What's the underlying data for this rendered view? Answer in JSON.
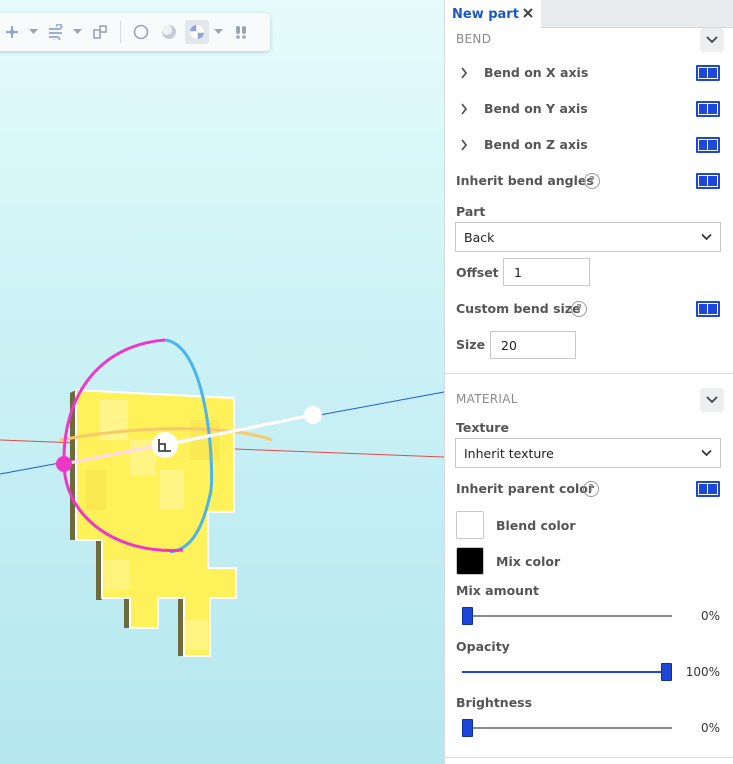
{
  "tab": {
    "title": "New part"
  },
  "toolbar": {
    "icons": [
      "move-icon",
      "wind-icon",
      "pivot-icon",
      "circle-icon",
      "half-shade-icon",
      "globe-icon",
      "footprint-icon"
    ]
  },
  "bend": {
    "section_title": "BEND",
    "axes": [
      {
        "label": "Bend on X axis",
        "enabled": true
      },
      {
        "label": "Bend on Y axis",
        "enabled": true
      },
      {
        "label": "Bend on Z axis",
        "enabled": true
      }
    ],
    "inherit_angles": {
      "label": "Inherit bend angles",
      "help": "?",
      "enabled": true
    },
    "part": {
      "label": "Part",
      "value": "Back"
    },
    "offset": {
      "label": "Offset",
      "value": "1"
    },
    "custom_size": {
      "label": "Custom bend size",
      "help": "?",
      "enabled": true
    },
    "size": {
      "label": "Size",
      "value": "20"
    }
  },
  "material": {
    "section_title": "MATERIAL",
    "texture": {
      "label": "Texture",
      "value": "Inherit texture"
    },
    "inherit_color": {
      "label": "Inherit parent color",
      "help": "?",
      "enabled": true
    },
    "blend_color": {
      "label": "Blend color",
      "color": "#ffffff"
    },
    "mix_color": {
      "label": "Mix color",
      "color": "#000000"
    },
    "mix_amount": {
      "label": "Mix amount",
      "value_text": "0%",
      "value": 0
    },
    "opacity": {
      "label": "Opacity",
      "value_text": "100%",
      "value": 100
    },
    "brightness": {
      "label": "Brightness",
      "value_text": "0%",
      "value": 0
    }
  },
  "colors": {
    "accent": "#1d47d8",
    "tab_text": "#1b57c9",
    "model_yellow": "#fff15a"
  }
}
